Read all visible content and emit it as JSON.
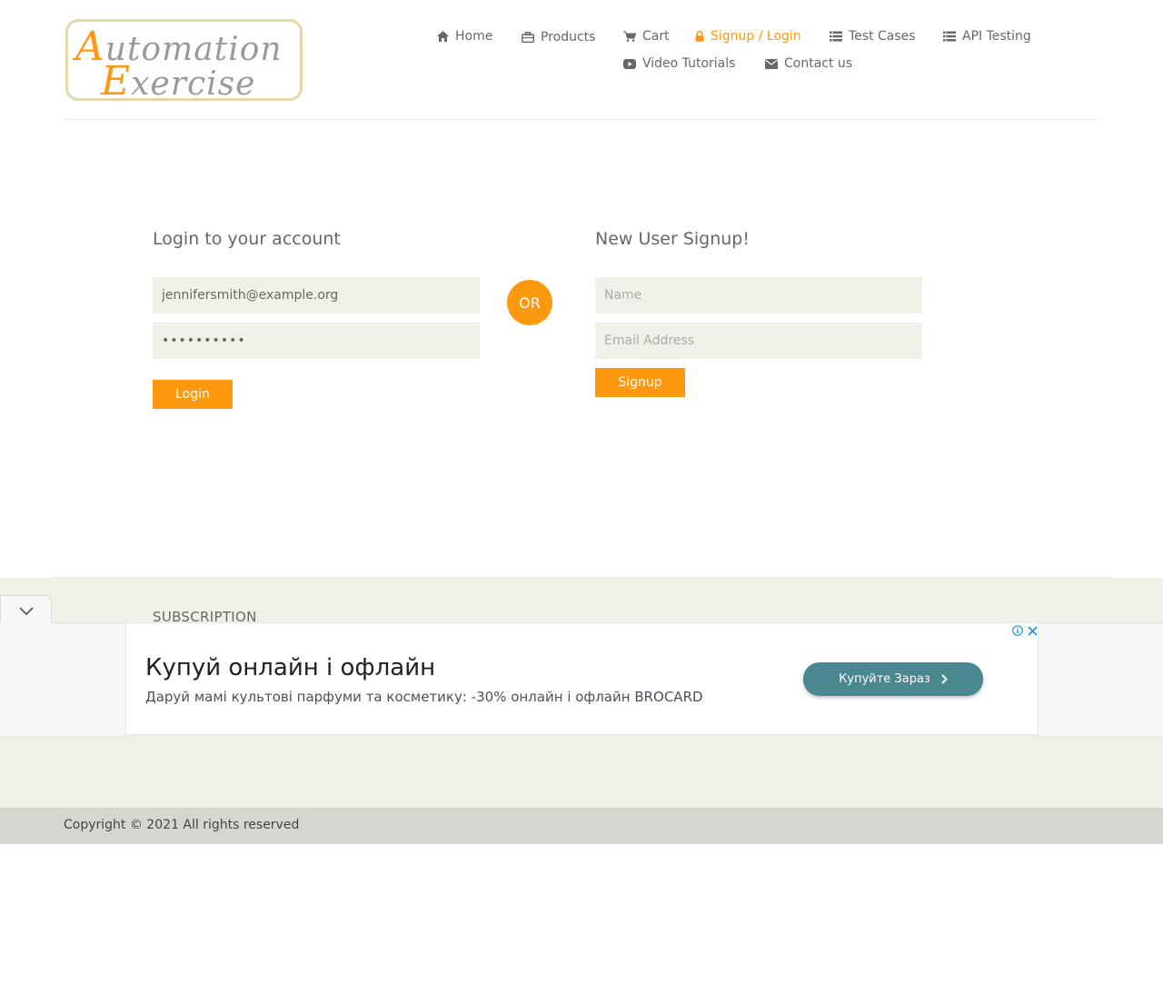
{
  "header": {
    "logo": {
      "line1_initial": "A",
      "line1_rest": "utomation",
      "line2_initial": "E",
      "line2_rest": "xercise"
    },
    "nav": [
      {
        "label": "Home",
        "icon": "home-icon"
      },
      {
        "label": "Products",
        "icon": "briefcase-icon"
      },
      {
        "label": "Cart",
        "icon": "shopping-cart-icon"
      },
      {
        "label": "Signup / Login",
        "icon": "lock-icon",
        "active": true
      },
      {
        "label": "Test Cases",
        "icon": "list-icon"
      },
      {
        "label": "API Testing",
        "icon": "list-icon"
      },
      {
        "label": "Video Tutorials",
        "icon": "youtube-play-icon"
      },
      {
        "label": "Contact us",
        "icon": "envelope-icon"
      }
    ]
  },
  "login": {
    "title": "Login to your account",
    "email_value": "jennifersmith@example.org",
    "password_value": "••••••••••",
    "button_label": "Login"
  },
  "or_label": "OR",
  "signup": {
    "title": "New User Signup!",
    "name_placeholder": "Name",
    "email_placeholder": "Email Address",
    "button_label": "Signup"
  },
  "footer": {
    "subscription_heading": "SUBSCRIPTION",
    "copyright": "Copyright © 2021 All rights reserved"
  },
  "ad": {
    "headline": "Купуй онлайн і офлайн",
    "description": "Даруй мамі культові парфуми та косметику: -30% онлайн і офлайн BROCARD",
    "cta_label": "Купуйте Зараз"
  },
  "colors": {
    "accent": "#fe980f",
    "text": "#696763",
    "field_bg": "#f0f0e9",
    "footer_bg": "#f0f0e9",
    "copyright_bg": "#d6d6d0",
    "ad_cta": "#4a8791",
    "ad_info": "#1a9bd7"
  }
}
